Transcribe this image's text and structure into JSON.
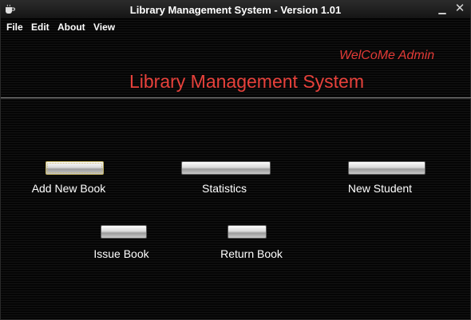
{
  "window": {
    "title": "Library Management System - Version 1.01",
    "minimize_glyph": "▁",
    "close_glyph": "✕"
  },
  "menu": [
    "File",
    "Edit",
    "About",
    "View"
  ],
  "header": {
    "welcome": "WelCoMe Admin",
    "title": "Library Management System"
  },
  "buttons": {
    "add_new_book": "Add New Book",
    "statistics": "Statistics",
    "new_student": "New Student",
    "issue_book": "Issue Book",
    "return_book": "Return Book"
  },
  "colors": {
    "accent_red": "#e7413b",
    "background": "#0c0c0c"
  }
}
